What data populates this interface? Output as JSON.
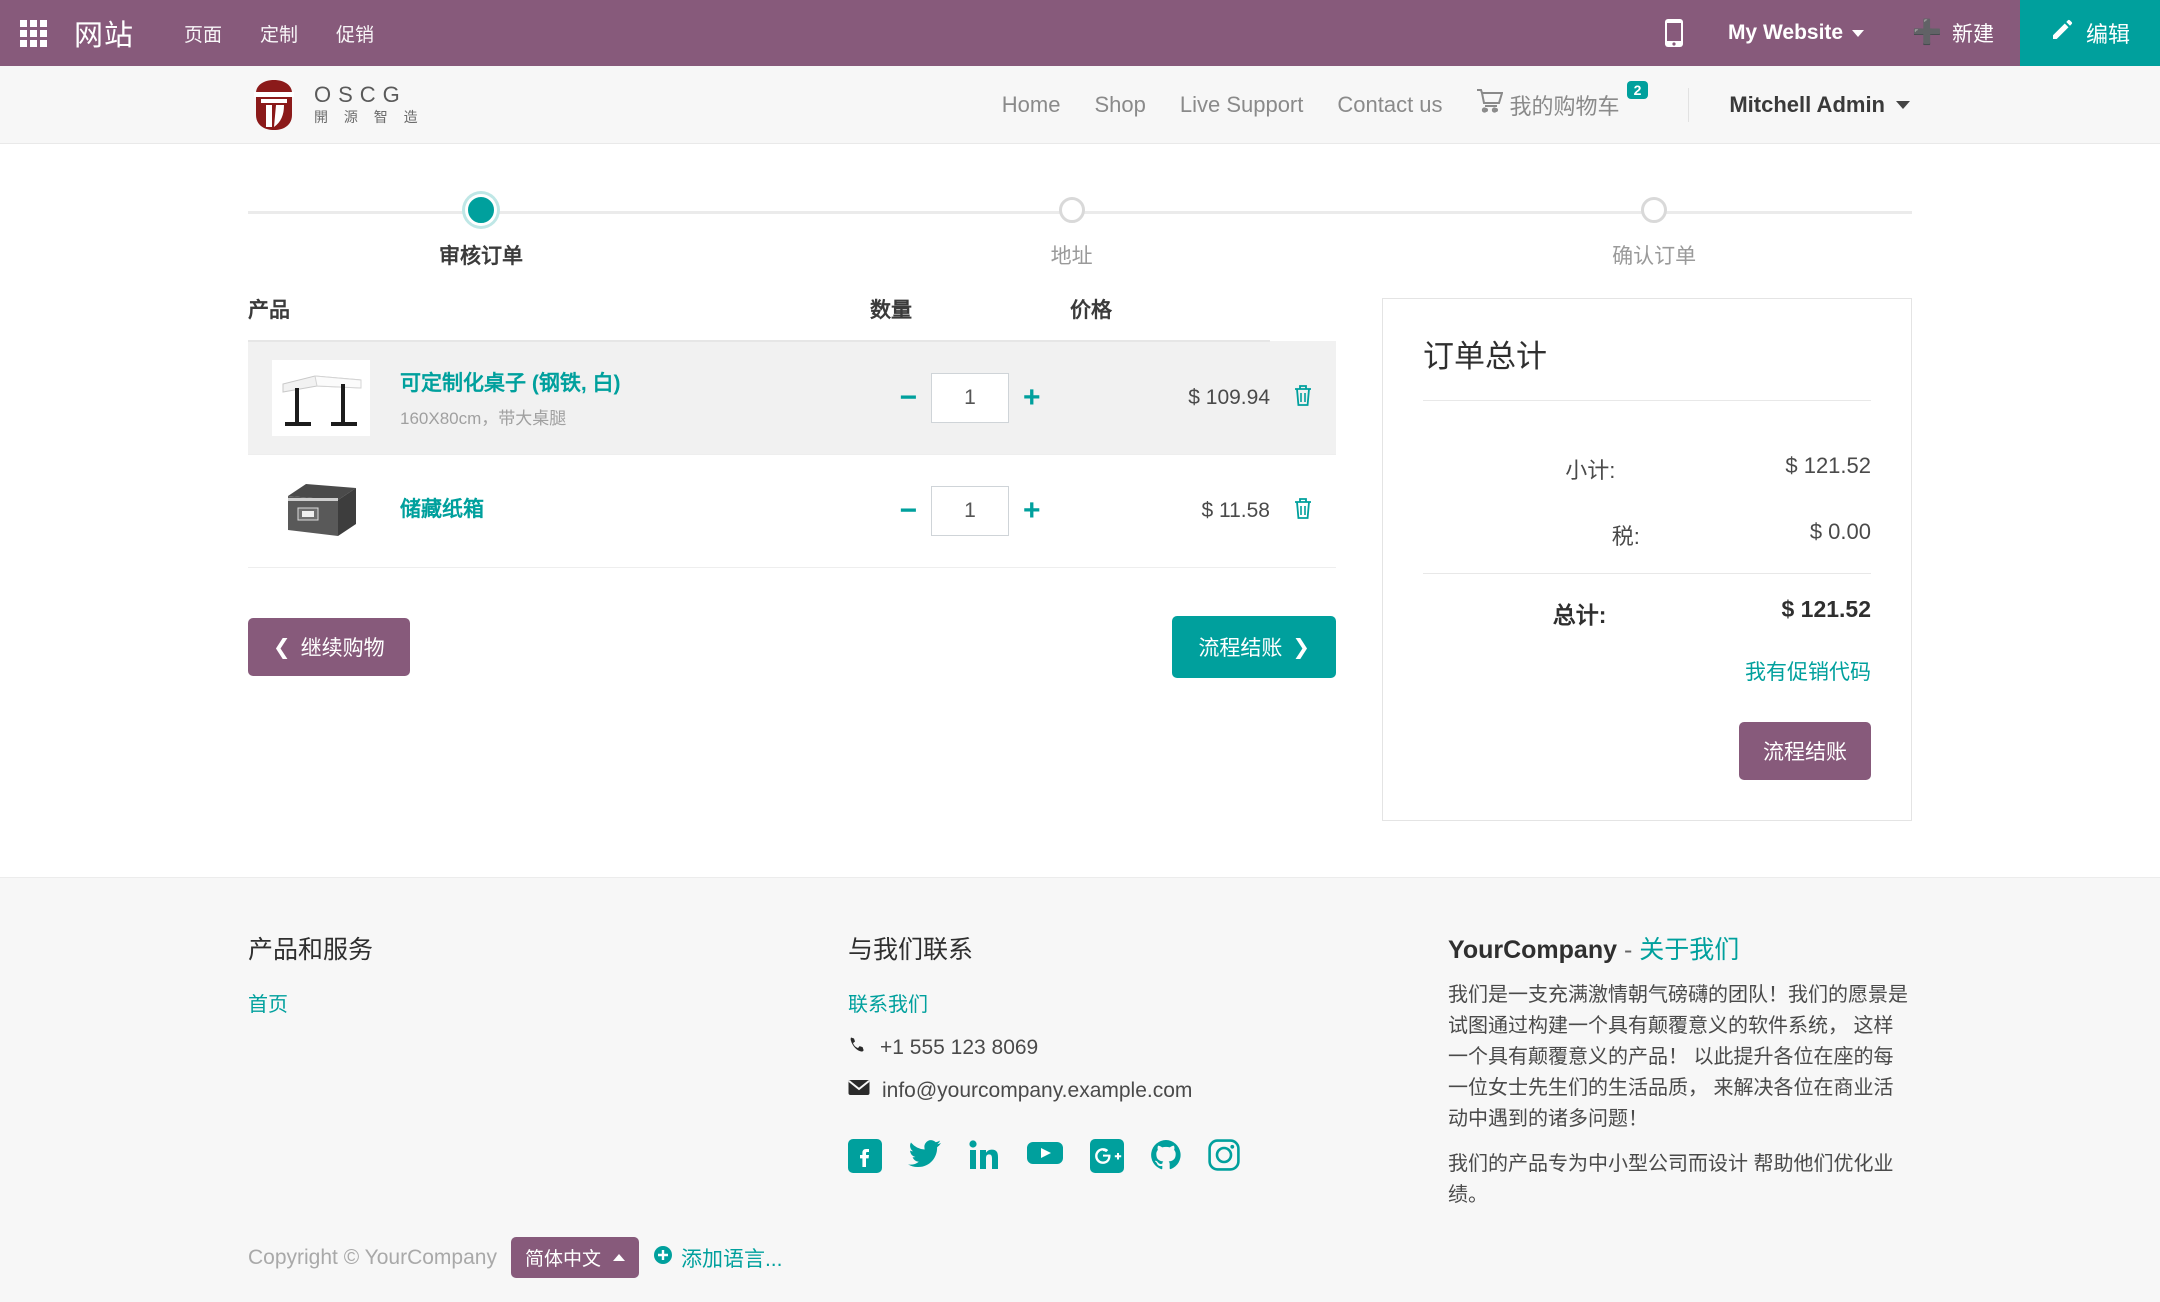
{
  "admin_bar": {
    "apps_icon": "grid-apps-icon",
    "title": "网站",
    "menu": [
      "页面",
      "定制",
      "促销"
    ],
    "mobile_icon": "mobile-preview-icon",
    "site_selector": "My Website",
    "new_label": "新建",
    "edit_label": "编辑",
    "bg_color": "#875a7b",
    "edit_color": "#00a09d"
  },
  "site_header": {
    "brand": {
      "name": "OSCG",
      "sub": "開 源 智 造",
      "logo_color": "#8b1a1a"
    },
    "nav": [
      {
        "label": "Home"
      },
      {
        "label": "Shop"
      },
      {
        "label": "Live Support"
      },
      {
        "label": "Contact us"
      }
    ],
    "cart": {
      "label": "我的购物车",
      "count": "2",
      "icon": "shopping-cart-icon"
    },
    "user": {
      "name": "Mitchell Admin"
    }
  },
  "wizard": {
    "steps": [
      {
        "label": "审核订单",
        "active": true
      },
      {
        "label": "地址",
        "active": false
      },
      {
        "label": "确认订单",
        "active": false
      }
    ]
  },
  "cart": {
    "headers": {
      "product": "产品",
      "quantity": "数量",
      "price": "价格"
    },
    "items": [
      {
        "name": "可定制化桌子 (钢铁, 白)",
        "description": "160X80cm，带大桌腿",
        "quantity": "1",
        "price": "$ 109.94",
        "thumb": "white-corner-desk-image",
        "remove_icon": "trash-icon"
      },
      {
        "name": "储藏纸箱",
        "description": "",
        "quantity": "1",
        "price": "$ 11.58",
        "thumb": "gray-storage-box-image",
        "remove_icon": "trash-icon"
      }
    ],
    "continue_label": "继续购物",
    "checkout_label": "流程结账"
  },
  "summary": {
    "title": "订单总计",
    "subtotal_label": "小计:",
    "subtotal_value": "$ 121.52",
    "tax_label": "税:",
    "tax_value": "$ 0.00",
    "total_label": "总计:",
    "total_value": "$ 121.52",
    "promo_label": "我有促销代码",
    "checkout_label": "流程结账"
  },
  "footer": {
    "col1": {
      "heading": "产品和服务",
      "links": [
        "首页"
      ]
    },
    "col2": {
      "heading": "与我们联系",
      "contact_link": "联系我们",
      "phone": "+1 555 123 8069",
      "email": "info@yourcompany.example.com",
      "socials": [
        "facebook-icon",
        "twitter-icon",
        "linkedin-icon",
        "youtube-icon",
        "googleplus-icon",
        "github-icon",
        "instagram-icon"
      ]
    },
    "col3": {
      "company": "YourCompany",
      "sep": "-",
      "about_link": "关于我们",
      "para1": "我们是一支充满激情朝气磅礴的团队！我们的愿景是试图通过构建一个具有颠覆意义的软件系统， 这样一个具有颠覆意义的产品！ 以此提升各位在座的每一位女士先生们的生活品质， 来解决各位在商业活动中遇到的诸多问题！",
      "para2": "我们的产品专为中小型公司而设计 帮助他们优化业绩。"
    }
  },
  "bottom_bar": {
    "copyright": "Copyright © YourCompany",
    "language": "简体中文",
    "add_language": "添加语言..."
  }
}
